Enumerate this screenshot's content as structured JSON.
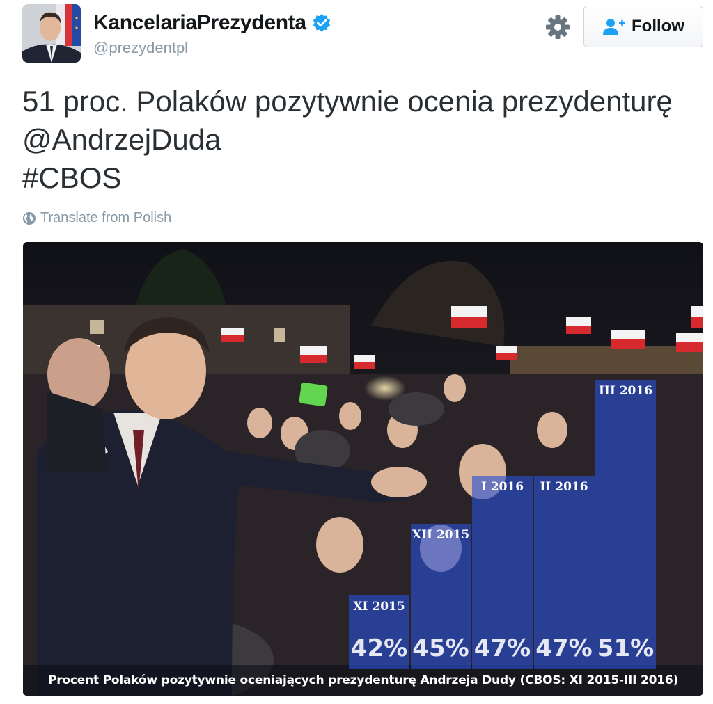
{
  "account": {
    "display_name": "KancelariaPrezydenta",
    "handle": "@prezydentpl",
    "verified": true
  },
  "actions": {
    "follow_label": "Follow"
  },
  "tweet": {
    "lines": [
      "51 proc. Polaków pozytywnie ocenia prezydenturę",
      "@AndrzejDuda",
      "#CBOS"
    ],
    "translate_label": "Translate from Polish"
  },
  "icons": {
    "settings": "gear-icon",
    "follow": "add-user-icon",
    "translate": "globe-icon",
    "verified": "verified-badge-icon"
  },
  "colors": {
    "verified": "#1da1f2",
    "follow_icon": "#1da1f2",
    "bar": "#2850d7"
  },
  "chart_data": {
    "type": "bar",
    "categories": [
      "XI 2015",
      "XII 2015",
      "I 2016",
      "II 2016",
      "III 2016"
    ],
    "values": [
      42,
      45,
      47,
      47,
      51
    ],
    "value_labels": [
      "42%",
      "45%",
      "47%",
      "47%",
      "51%"
    ],
    "caption": "Procent Polaków pozytywnie oceniających prezydenturę Andrzeja Dudy (CBOS: XI 2015-III 2016)"
  }
}
